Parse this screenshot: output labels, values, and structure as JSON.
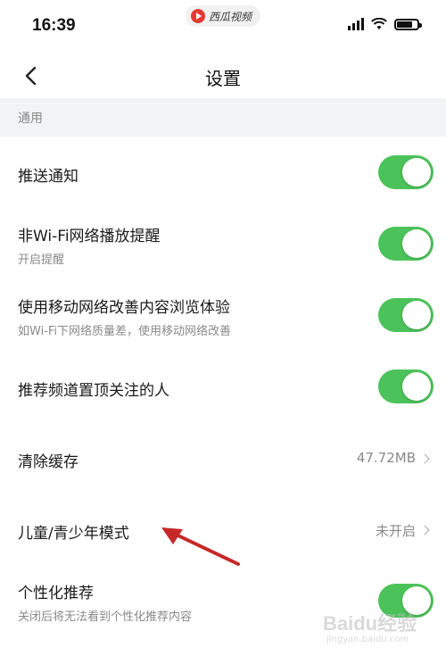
{
  "status_bar": {
    "time": "16:39",
    "source_app": "西瓜视频",
    "icons": [
      "signal-icon",
      "wifi-icon",
      "battery-icon"
    ]
  },
  "nav": {
    "title": "设置",
    "back_icon": "chevron-left-icon"
  },
  "section": {
    "label": "通用"
  },
  "rows": [
    {
      "title": "推送通知",
      "subtitle": "",
      "control": "toggle",
      "on": true
    },
    {
      "title": "非Wi-Fi网络播放提醒",
      "subtitle": "开启提醒",
      "control": "toggle",
      "on": true
    },
    {
      "title": "使用移动网络改善内容浏览体验",
      "subtitle": "如Wi-Fi下网络质量差，使用移动网络改善",
      "control": "toggle",
      "on": true
    },
    {
      "title": "推荐频道置顶关注的人",
      "subtitle": "",
      "control": "toggle",
      "on": true
    },
    {
      "title": "清除缓存",
      "subtitle": "",
      "control": "value",
      "value": "47.72MB"
    },
    {
      "title": "儿童/青少年模式",
      "subtitle": "",
      "control": "value",
      "value": "未开启"
    },
    {
      "title": "个性化推荐",
      "subtitle": "关闭后将无法看到个性化推荐内容",
      "control": "toggle",
      "on": true
    }
  ],
  "annotation": {
    "arrow_color": "#c62828",
    "points_to": "儿童/青少年模式"
  },
  "watermark": {
    "text": "Baidu经验",
    "sub": "jingyan.baidu.com"
  },
  "colors": {
    "toggle_on": "#4cc35a",
    "section_bg": "#f2f3f5",
    "annotation_arrow": "#c62828"
  }
}
